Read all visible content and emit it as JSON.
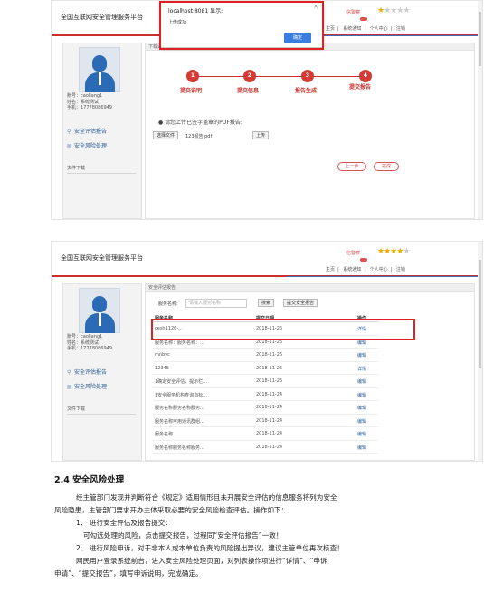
{
  "header": {
    "title": "全国互联网安全管理服务平台",
    "user_label": "信警察",
    "nav": [
      "主页",
      "系统通知",
      "个人中心",
      "注销"
    ]
  },
  "user": {
    "account": "账号：caoliang1",
    "name": "姓名：系统测试",
    "phone": "手机：17778086949"
  },
  "menu": {
    "eval_report": "安全评估报告",
    "risk_handle": "安全风险处理",
    "doc_download": "文件下载"
  },
  "screenshot1": {
    "tab": "下载评估文件",
    "steps": [
      "提交说明",
      "提交信息",
      "报告生成",
      "提交报告"
    ],
    "upload_prompt": "请您上传已签字盖章的PDF报告:",
    "choose_file_btn": "选择文件",
    "filename": "123报告.pdf",
    "upload_btn": "上传",
    "prev_btn": "上一步",
    "finish_btn": "完成",
    "dialog": {
      "title": "localhost:8081 显示:",
      "message": "上传成功",
      "ok": "确定",
      "close": "×"
    },
    "star_rating": 1
  },
  "screenshot2": {
    "tab": "安全评估报告",
    "search_label": "服务名称:",
    "search_placeholder": "请输入服务名称",
    "search_btn": "搜索",
    "submit_btn": "提交安全报告",
    "columns": [
      "服务名称",
      "提交日期",
      "操作"
    ],
    "rows": [
      {
        "name": "cesh1126-...",
        "date": "2018-11-26",
        "op": "详情"
      },
      {
        "name": "服务名称：服务名称：...",
        "date": "2018-11-26",
        "op": "编辑"
      },
      {
        "name": "mnbvc",
        "date": "2018-11-26",
        "op": "编辑"
      },
      {
        "name": "12345",
        "date": "2018-11-26",
        "op": "详情"
      },
      {
        "name": "1确定安全评估，提示栏...",
        "date": "2018-11-26",
        "op": "编辑"
      },
      {
        "name": "1安全服务机构查询指标...",
        "date": "2018-11-24",
        "op": "编辑"
      },
      {
        "name": "服务名称服务名称服务...",
        "date": "2018-11-24",
        "op": "编辑"
      },
      {
        "name": "服务名称可用通讯群组...",
        "date": "2018-11-24",
        "op": "编辑"
      },
      {
        "name": "服务名称",
        "date": "2018-11-24",
        "op": "编辑"
      },
      {
        "name": "服务名称服务名称服务...",
        "date": "2018-11-24",
        "op": "编辑"
      }
    ],
    "star_rating": 4
  },
  "doc": {
    "heading": "2.4 安全风险处理",
    "p1a": "经主管部门发现并判断符合《规定》适用情形且未开展安全评估的信息服务将列为安全",
    "p1b": "风险隐患，主管部门要求开办主体采取必要的安全风险检查评估。操作如下：",
    "item1": "1、 进行安全评估及报告提交：",
    "item1_detail": "可勾选处理的风险，点击提交报告，过程同“安全评估报告”一致！",
    "item2": "2、 进行风险申诉，对于非本人或本单位负责的风险提出异议，建议主管单位再次核查！",
    "p2a": "网民用户登录系统前台，进入安全风险处理页面，对列表操作项进行“详情”、“申诉",
    "p2b": "申请”、“提交报告”，填写申诉说明，完成确定。"
  }
}
